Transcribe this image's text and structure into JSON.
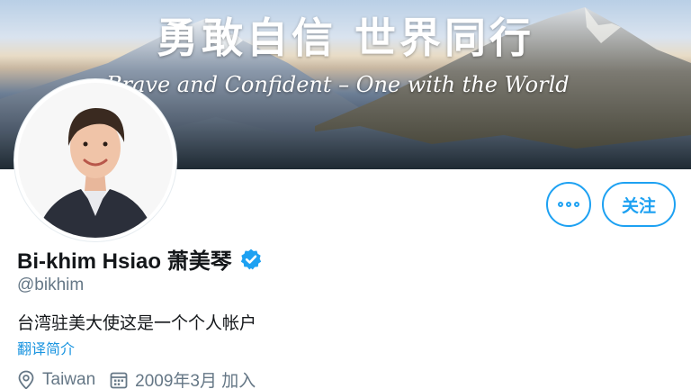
{
  "banner": {
    "title": "勇敢自信 世界同行",
    "subtitle": "Brave and Confident – One with the World"
  },
  "profile": {
    "display_name": "Bi-khim Hsiao 萧美琴",
    "verified": true,
    "handle": "@bikhim",
    "bio": "台湾驻美大使这是一个个人帐户",
    "translate_label": "翻译简介",
    "location": "Taiwan",
    "joined": "2009年3月 加入"
  },
  "actions": {
    "more_icon": "more-dots-icon",
    "follow_label": "关注"
  },
  "colors": {
    "accent": "#1da1f2",
    "link": "#1b95e0",
    "secondary_text": "#657786",
    "primary_text": "#14171a"
  }
}
